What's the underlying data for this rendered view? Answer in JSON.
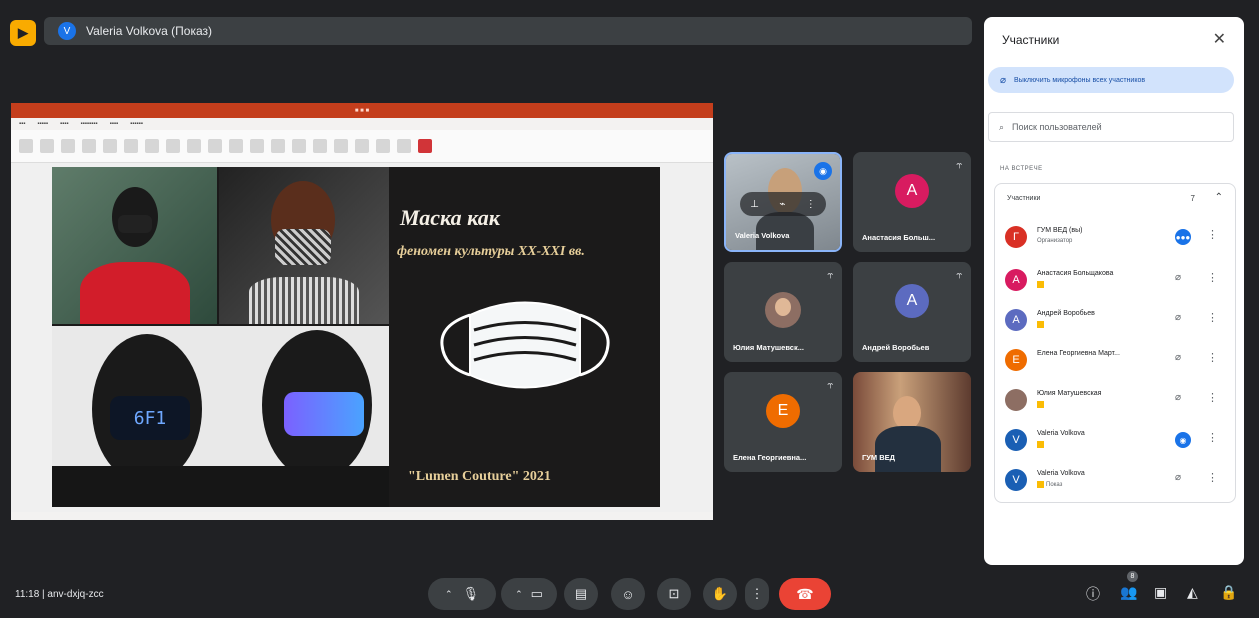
{
  "top": {
    "presenter_avatar": "V",
    "presenter_label": "Valeria Volkova (Показ)"
  },
  "presentation": {
    "slide_title_line1": "Маска как",
    "slide_title_line2": "феномен культуры XX-XXI вв.",
    "slide_footer": "\"Lumen Couture\" 2021"
  },
  "tiles": [
    {
      "name": "Valeria Volkova",
      "avatar": "",
      "color": "#5f6368"
    },
    {
      "name": "Анастасия Больш...",
      "avatar": "А",
      "color": "#d81b60"
    },
    {
      "name": "Юлия Матушевск...",
      "avatar": "",
      "color": "#5f6368"
    },
    {
      "name": "Андрей Воробьев",
      "avatar": "А",
      "color": "#5c6bc0"
    },
    {
      "name": "Елена Георгиевна...",
      "avatar": "Е",
      "color": "#ef6c00"
    },
    {
      "name": "ГУМ ВЕД",
      "avatar": "",
      "color": "#5f6368"
    }
  ],
  "panel": {
    "title": "Участники",
    "mute_all": "Выключить микрофоны всех участников",
    "search_placeholder": "Поиск пользователей",
    "section": "НА ВСТРЕЧЕ",
    "group_label": "Участники",
    "group_count": "7",
    "participants": [
      {
        "avatar": "Г",
        "color": "#d93025",
        "name": "ГУМ ВЕД (вы)",
        "sub": "Организатор",
        "mic": "on"
      },
      {
        "avatar": "А",
        "color": "#d81b60",
        "name": "Анастасия Больщакова",
        "sub": "",
        "mic": "off"
      },
      {
        "avatar": "А",
        "color": "#5c6bc0",
        "name": "Андрей Воробьев",
        "sub": "",
        "mic": "off"
      },
      {
        "avatar": "Е",
        "color": "#ef6c00",
        "name": "Елена Георгиевна Март...",
        "sub": "",
        "mic": "off"
      },
      {
        "avatar": "",
        "color": "#8d6e63",
        "name": "Юлия Матушевская",
        "sub": "",
        "mic": "off"
      },
      {
        "avatar": "V",
        "color": "#1a5fb4",
        "name": "Valeria Volkova",
        "sub": "",
        "mic": "on"
      },
      {
        "avatar": "V",
        "color": "#1a5fb4",
        "name": "Valeria Volkova",
        "sub": "Показ",
        "mic": "off"
      }
    ]
  },
  "bottom": {
    "time_code": "11:18  |  anv-dxjq-zcc",
    "participant_badge": "8"
  },
  "colors": {
    "accent": "#1a73e8",
    "leave": "#ea4335",
    "background": "#202124"
  }
}
